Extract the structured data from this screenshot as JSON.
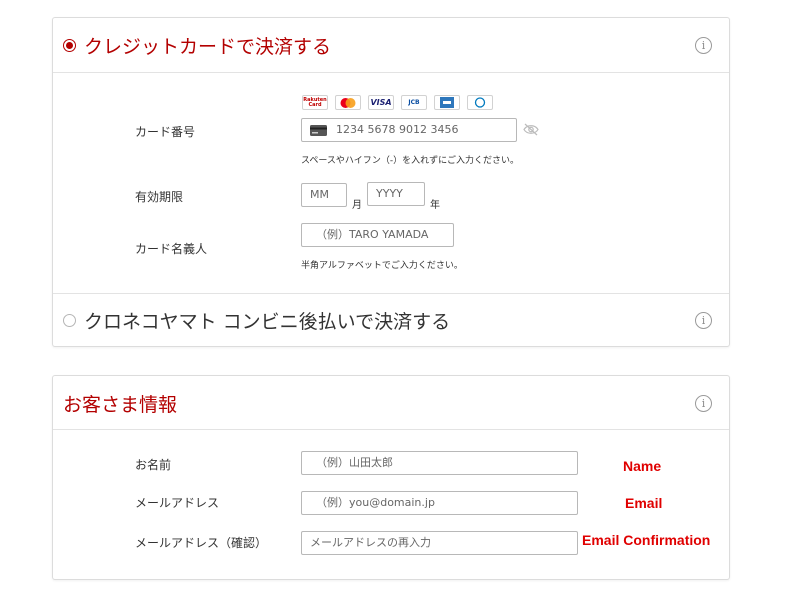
{
  "payment": {
    "credit_option": {
      "title": "クレジットカードで決済する",
      "selected": true
    },
    "card_brands": [
      "rakuten-card-icon",
      "mastercard-icon",
      "visa-icon",
      "jcb-icon",
      "amex-icon",
      "diners-icon"
    ],
    "rakuten_logo_text": "Rakuten Card",
    "visa_text": "VISA",
    "jcb_text": "JCB",
    "card_number_label": "カード番号",
    "card_number_placeholder": "1234 5678 9012 3456",
    "card_number_hint": "スペースやハイフン（-）を入れずにご入力ください。",
    "expiry_label": "有効期限",
    "expiry_month_placeholder": "MM",
    "expiry_month_unit": "月",
    "expiry_year_placeholder": "YYYY",
    "expiry_year_unit": "年",
    "holder_label": "カード名義人",
    "holder_placeholder": "（例）TARO YAMADA",
    "holder_hint": "半角アルファベットでご入力ください。",
    "kuroneko_option": {
      "title": "クロネコヤマト コンビニ後払いで決済する",
      "selected": false
    }
  },
  "customer": {
    "title": "お客さま情報",
    "name_label": "お名前",
    "name_placeholder": "（例）山田太郎",
    "email_label": "メールアドレス",
    "email_placeholder": "（例）you@domain.jp",
    "email_confirm_label": "メールアドレス（確認）",
    "email_confirm_placeholder": "メールアドレスの再入力"
  },
  "annotations": {
    "name": "Name",
    "email": "Email",
    "email_confirmation": "Email Confirmation"
  },
  "colors": {
    "accent": "#b30000",
    "annotation": "#e00000"
  },
  "info_icon_glyph": "i"
}
